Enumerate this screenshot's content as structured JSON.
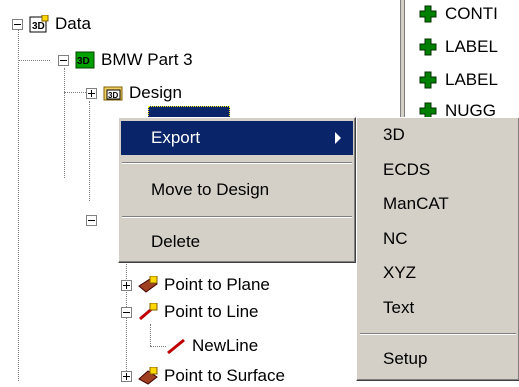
{
  "tree": {
    "root_label": "Data",
    "part_label": "BMW Part 3",
    "design_label": "Design",
    "point_to_plane": "Point to Plane",
    "point_to_line": "Point to Line",
    "new_line": "NewLine",
    "point_to_surface": "Point to Surface"
  },
  "right_panel": {
    "items": [
      "CONTI",
      "LABEL",
      "LABEL",
      "NUGG"
    ]
  },
  "context_menu": {
    "items": [
      "Export",
      "Move to Design",
      "Delete"
    ]
  },
  "export_submenu": {
    "items": [
      "3D",
      "ECDS",
      "ManCAT",
      "NC",
      "XYZ",
      "Text",
      "Setup"
    ]
  },
  "colors": {
    "selection": "#0a246a",
    "menu_face": "#d4d0c8",
    "icon_green": "#008000"
  }
}
